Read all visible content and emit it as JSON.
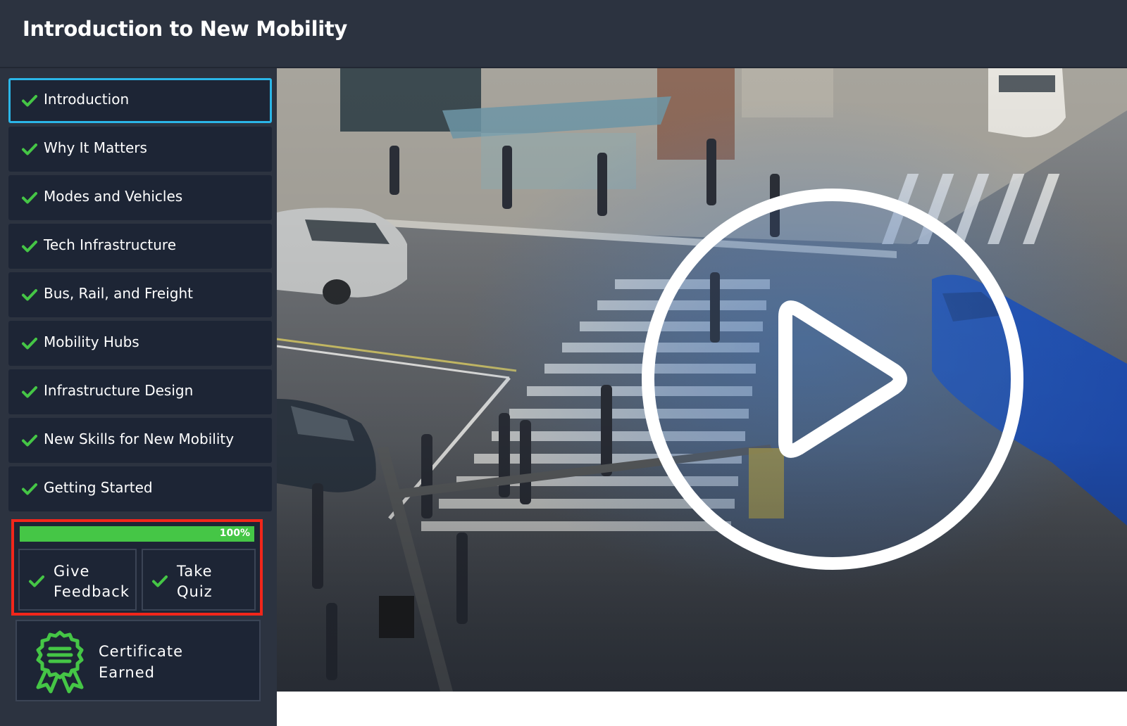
{
  "header": {
    "title": "Introduction to New Mobility"
  },
  "sidebar": {
    "items": [
      {
        "label": "Introduction",
        "active": true,
        "completed": true
      },
      {
        "label": "Why It Matters",
        "active": false,
        "completed": true
      },
      {
        "label": "Modes and Vehicles",
        "active": false,
        "completed": true
      },
      {
        "label": "Tech Infrastructure",
        "active": false,
        "completed": true
      },
      {
        "label": "Bus, Rail, and Freight",
        "active": false,
        "completed": true
      },
      {
        "label": "Mobility Hubs",
        "active": false,
        "completed": true
      },
      {
        "label": "Infrastructure Design",
        "active": false,
        "completed": true
      },
      {
        "label": "New Skills for New Mobility",
        "active": false,
        "completed": true
      },
      {
        "label": "Getting Started",
        "active": false,
        "completed": true
      }
    ]
  },
  "progress": {
    "percent": 100,
    "label": "100%"
  },
  "actions": {
    "feedback_label": "Give\nFeedback",
    "quiz_label": "Take\nQuiz"
  },
  "certificate": {
    "label": "Certificate\nEarned"
  },
  "icons": {
    "check": "check-icon",
    "certificate": "ribbon-badge-icon",
    "play": "play-icon"
  },
  "colors": {
    "header_bg": "#2c3340",
    "nav_item_bg": "#1d2535",
    "active_border": "#2bb6e8",
    "check_green": "#45c646",
    "highlight_red": "#f2261a"
  }
}
